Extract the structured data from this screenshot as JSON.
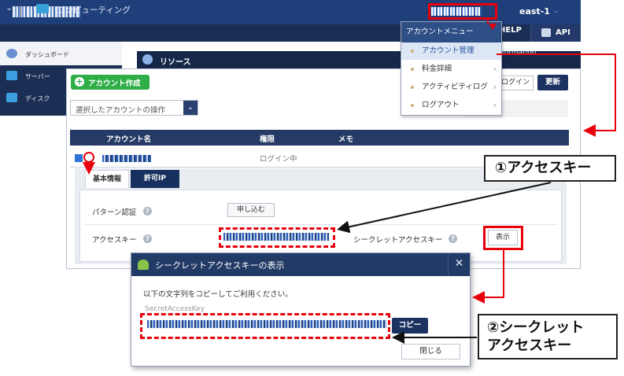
{
  "header": {
    "region": "east-1",
    "help_label": "HELP",
    "api_label": "API"
  },
  "nav": {
    "section_label": "コンピューティング"
  },
  "sidebar": {
    "items": [
      {
        "label": "ダッシュボード"
      },
      {
        "label": "サーバー"
      },
      {
        "label": "ディスク"
      }
    ]
  },
  "resource": {
    "title": "リソース",
    "information_label": "nformation"
  },
  "account_menu": {
    "title": "アカウントメニュー",
    "items": [
      {
        "label": "アカウント管理"
      },
      {
        "label": "料金詳細"
      },
      {
        "label": "アクティビティログ"
      },
      {
        "label": "ログアウト"
      }
    ]
  },
  "toolbar": {
    "create_label": "アカウント作成",
    "login_label": "ログイン",
    "refresh_label": "更新",
    "action_select_value": "選択したアカウントの操作"
  },
  "table": {
    "headers": [
      "アカウント名",
      "権限",
      "メモ"
    ],
    "row1_permission": "ログイン中"
  },
  "detail": {
    "tabs": [
      "基本情報",
      "許可IP"
    ],
    "pattern_auth_label": "パターン認証",
    "apply_label": "申し込む",
    "access_key_label": "アクセスキー",
    "secret_key_label": "シークレットアクセスキー",
    "show_label": "表示"
  },
  "modal": {
    "title": "シークレットアクセスキーの表示",
    "description": "以下の文字列をコピーしてご利用ください。",
    "key_label": "SecretAccessKey",
    "copy_label": "コピー",
    "close_label": "閉じる"
  },
  "callouts": {
    "access_key": "①アクセスキー",
    "secret_line1": "②シークレット",
    "secret_line2": "アクセスキー"
  }
}
